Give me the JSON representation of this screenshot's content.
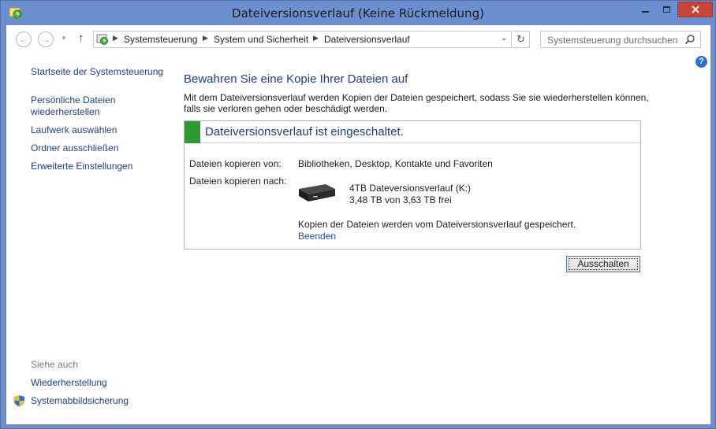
{
  "window": {
    "title": "Dateiversionsverlauf (Keine Rückmeldung)"
  },
  "address_bar": {
    "crumbs": [
      "Systemsteuerung",
      "System und Sicherheit",
      "Dateiversionsverlauf"
    ]
  },
  "search": {
    "placeholder": "Systemsteuerung durchsuchen"
  },
  "sidebar": {
    "links": [
      "Startseite der Systemsteuerung",
      "Persönliche Dateien",
      "wiederherstellen",
      "Laufwerk auswählen",
      "Ordner ausschließen",
      "Erweiterte Einstellungen"
    ],
    "see_also_label": "Siehe auch",
    "see_also": [
      "Wiederherstellung",
      "Systemabbildsicherung"
    ]
  },
  "main": {
    "title": "Bewahren Sie eine Kopie Ihrer Dateien auf",
    "description": "Mit dem Dateiversionsverlauf werden Kopien der Dateien gespeichert, sodass Sie sie wiederherstellen können, falls sie verloren gehen oder beschädigt werden.",
    "status_title": "Dateiversionsverlauf ist eingeschaltet.",
    "copy_from_label": "Dateien kopieren von:",
    "copy_from_value": "Bibliotheken, Desktop, Kontakte und Favoriten",
    "copy_to_label": "Dateien kopieren nach:",
    "drive_name": "4TB Dateversionsverlauf (K:)",
    "drive_free": "3,48 TB von 3,63 TB frei",
    "copy_status": "Kopien der Dateien werden vom Dateiversionsverlauf gespeichert.",
    "stop_link": "Beenden",
    "off_button": "Ausschalten"
  },
  "icons": {
    "title": "file-history-icon",
    "address": "control-panel-icon",
    "drive": "external-drive-icon",
    "shield": "uac-shield-icon"
  },
  "colors": {
    "titlebar": "#6b8fcf",
    "link": "#1c3f94",
    "status_green": "#2d9a32",
    "close": "#c7463a"
  }
}
